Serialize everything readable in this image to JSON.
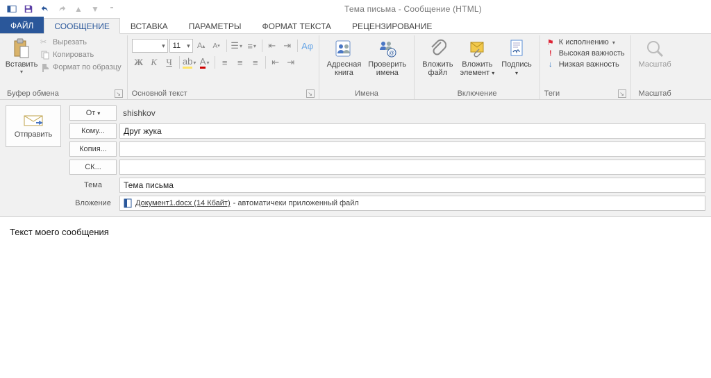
{
  "title": "Тема письма - Сообщение (HTML)",
  "tabs": {
    "file": "ФАЙЛ",
    "message": "СООБЩЕНИЕ",
    "insert": "ВСТАВКА",
    "options": "ПАРАМЕТРЫ",
    "format": "ФОРМАТ ТЕКСТА",
    "review": "РЕЦЕНЗИРОВАНИЕ"
  },
  "ribbon": {
    "clipboard": {
      "paste": "Вставить",
      "cut": "Вырезать",
      "copy": "Копировать",
      "fmt_painter": "Формат по образцу",
      "group": "Буфер обмена"
    },
    "font": {
      "size": "11",
      "group": "Основной текст"
    },
    "names": {
      "addr_book1": "Адресная",
      "addr_book2": "книга",
      "check1": "Проверить",
      "check2": "имена",
      "group": "Имена"
    },
    "include": {
      "attach_file1": "Вложить",
      "attach_file2": "файл",
      "attach_item1": "Вложить",
      "attach_item2": "элемент",
      "signature": "Подпись",
      "group": "Включение"
    },
    "tags": {
      "followup": "К исполнению",
      "high": "Высокая важность",
      "low": "Низкая важность",
      "group": "Теги"
    },
    "zoom": {
      "label": "Масштаб",
      "group": "Масштаб"
    }
  },
  "form": {
    "send": "Отправить",
    "from_label": "От",
    "from_value": "shishkov",
    "to_label": "Кому...",
    "to_value": "Друг жука",
    "cc_label": "Копия...",
    "cc_value": "",
    "bcc_label": "СК...",
    "bcc_value": "",
    "subject_label": "Тема",
    "subject_value": "Тема письма",
    "attach_label": "Вложение",
    "attach_name": "Документ1.docx (14 Кбайт)",
    "attach_note": "- автоматичеки приложенный файл"
  },
  "body_text": "Текст моего сообщения"
}
